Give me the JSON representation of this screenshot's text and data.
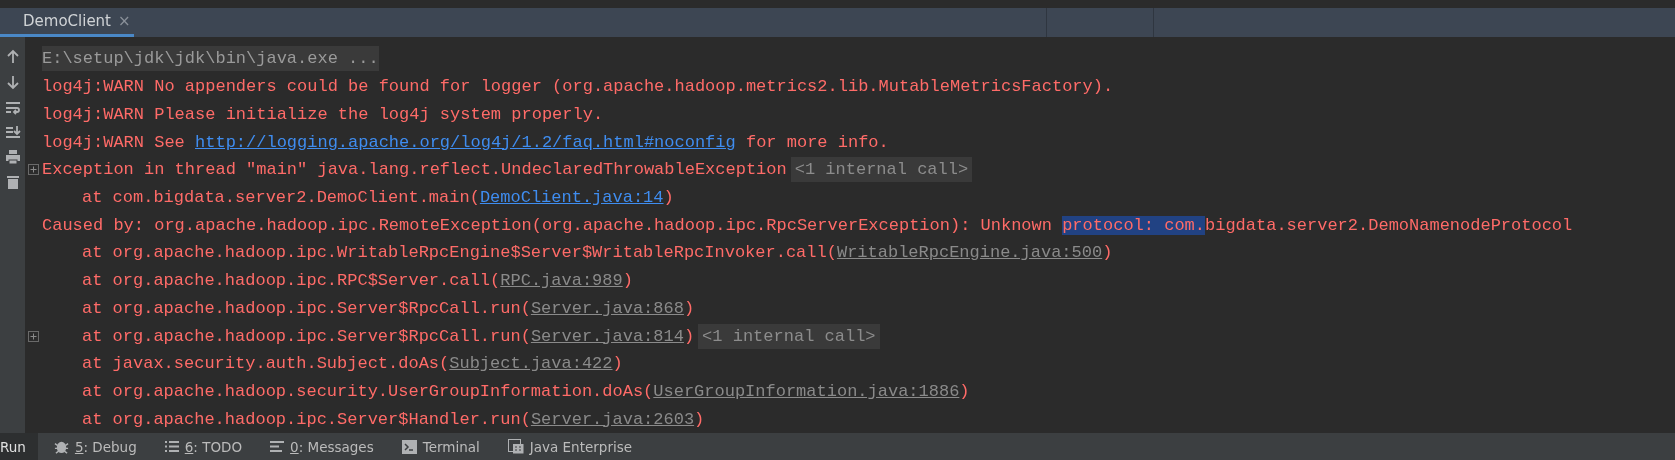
{
  "tab": {
    "title": "DemoClient",
    "selected": true,
    "close": "×"
  },
  "console": {
    "lines": [
      {
        "foldable": false,
        "indented": false,
        "segments": [
          {
            "kind": "command",
            "text": "E:\\setup\\jdk\\jdk\\bin\\java.exe ..."
          }
        ]
      },
      {
        "foldable": false,
        "indented": false,
        "segments": [
          {
            "kind": "error",
            "text": "log4j:WARN No appenders could be found for logger (org.apache.hadoop.metrics2.lib.MutableMetricsFactory)."
          }
        ]
      },
      {
        "foldable": false,
        "indented": false,
        "segments": [
          {
            "kind": "error",
            "text": "log4j:WARN Please initialize the log4j system properly."
          }
        ]
      },
      {
        "foldable": false,
        "indented": false,
        "segments": [
          {
            "kind": "error",
            "text": "log4j:WARN See "
          },
          {
            "kind": "link",
            "text": "http://logging.apache.org/log4j/1.2/faq.html#noconfig"
          },
          {
            "kind": "error",
            "text": " for more info."
          }
        ]
      },
      {
        "foldable": true,
        "indented": false,
        "segments": [
          {
            "kind": "error",
            "text": "Exception in thread \"main\" java.lang.reflect.UndeclaredThrowableException"
          },
          {
            "kind": "hint",
            "text": "<1 internal call>"
          }
        ]
      },
      {
        "foldable": false,
        "indented": true,
        "segments": [
          {
            "kind": "error",
            "text": "at com.bigdata.server2.DemoClient.main("
          },
          {
            "kind": "link",
            "text": "DemoClient.java:14"
          },
          {
            "kind": "error",
            "text": ")"
          }
        ]
      },
      {
        "foldable": false,
        "indented": false,
        "segments": [
          {
            "kind": "error",
            "text": "Caused by: org.apache.hadoop.ipc.RemoteException(org.apache.hadoop.ipc.RpcServerException): Unknown "
          },
          {
            "kind": "selection",
            "text": "protocol: com."
          },
          {
            "kind": "error",
            "text": "bigdata.server2.DemoNamenodeProtocol"
          }
        ]
      },
      {
        "foldable": false,
        "indented": true,
        "segments": [
          {
            "kind": "error",
            "text": "at org.apache.hadoop.ipc.WritableRpcEngine$Server$WritableRpcInvoker.call("
          },
          {
            "kind": "source",
            "text": "WritableRpcEngine.java:500"
          },
          {
            "kind": "error",
            "text": ")"
          }
        ]
      },
      {
        "foldable": false,
        "indented": true,
        "segments": [
          {
            "kind": "error",
            "text": "at org.apache.hadoop.ipc.RPC$Server.call("
          },
          {
            "kind": "source",
            "text": "RPC.java:989"
          },
          {
            "kind": "error",
            "text": ")"
          }
        ]
      },
      {
        "foldable": false,
        "indented": true,
        "segments": [
          {
            "kind": "error",
            "text": "at org.apache.hadoop.ipc.Server$RpcCall.run("
          },
          {
            "kind": "source",
            "text": "Server.java:868"
          },
          {
            "kind": "error",
            "text": ")"
          }
        ]
      },
      {
        "foldable": true,
        "indented": true,
        "segments": [
          {
            "kind": "error",
            "text": "at org.apache.hadoop.ipc.Server$RpcCall.run("
          },
          {
            "kind": "source",
            "text": "Server.java:814"
          },
          {
            "kind": "error",
            "text": ")"
          },
          {
            "kind": "hint",
            "text": "<1 internal call>"
          }
        ]
      },
      {
        "foldable": false,
        "indented": true,
        "segments": [
          {
            "kind": "error",
            "text": "at javax.security.auth.Subject.doAs("
          },
          {
            "kind": "source",
            "text": "Subject.java:422"
          },
          {
            "kind": "error",
            "text": ")"
          }
        ]
      },
      {
        "foldable": false,
        "indented": true,
        "segments": [
          {
            "kind": "error",
            "text": "at org.apache.hadoop.security.UserGroupInformation.doAs("
          },
          {
            "kind": "source",
            "text": "UserGroupInformation.java:1886"
          },
          {
            "kind": "error",
            "text": ")"
          }
        ]
      },
      {
        "foldable": false,
        "indented": true,
        "segments": [
          {
            "kind": "error",
            "text": "at org.apache.hadoop.ipc.Server$Handler.run("
          },
          {
            "kind": "source",
            "text": "Server.java:2603"
          },
          {
            "kind": "error",
            "text": ")"
          }
        ]
      }
    ]
  },
  "bottom_bar": [
    {
      "kind": "run",
      "label": "Run",
      "selected": true
    },
    {
      "kind": "debug",
      "key": "5",
      "label": ": Debug",
      "selected": false
    },
    {
      "kind": "todo",
      "key": "6",
      "label": ": TODO",
      "selected": false
    },
    {
      "kind": "messages",
      "key": "0",
      "label": ": Messages",
      "selected": false
    },
    {
      "kind": "terminal",
      "label": "Terminal",
      "selected": false
    },
    {
      "kind": "enterprise",
      "label": "Java Enterprise",
      "selected": false
    }
  ]
}
